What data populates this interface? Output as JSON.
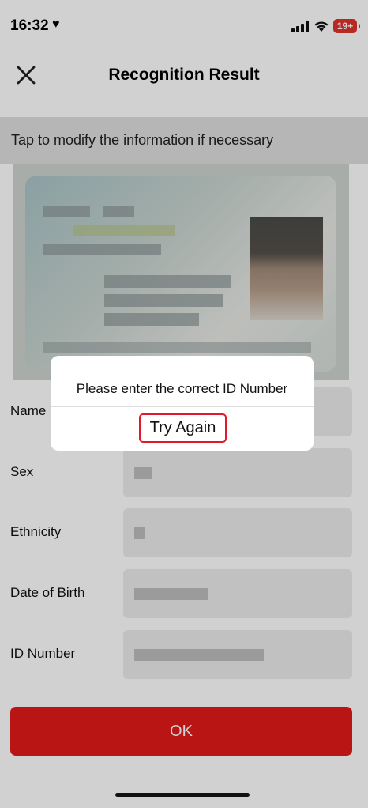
{
  "status_bar": {
    "time": "16:32",
    "battery": "19+"
  },
  "header": {
    "title": "Recognition Result"
  },
  "hint": {
    "text": "Tap to modify the information if necessary"
  },
  "form": {
    "fields": [
      {
        "label": "Name"
      },
      {
        "label": "Sex"
      },
      {
        "label": "Ethnicity"
      },
      {
        "label": "Date of Birth"
      },
      {
        "label": "ID Number"
      }
    ]
  },
  "ok_button": {
    "label": "OK"
  },
  "dialog": {
    "message": "Please enter the correct ID Number",
    "button_label": "Try Again"
  },
  "colors": {
    "primary_red": "#e21a1a",
    "highlight_outline": "#e2192a",
    "battery_red": "#e0342b"
  },
  "icons": {
    "close": "close-icon",
    "signal": "cellular-signal-icon",
    "wifi": "wifi-icon",
    "heart": "heart-icon"
  }
}
